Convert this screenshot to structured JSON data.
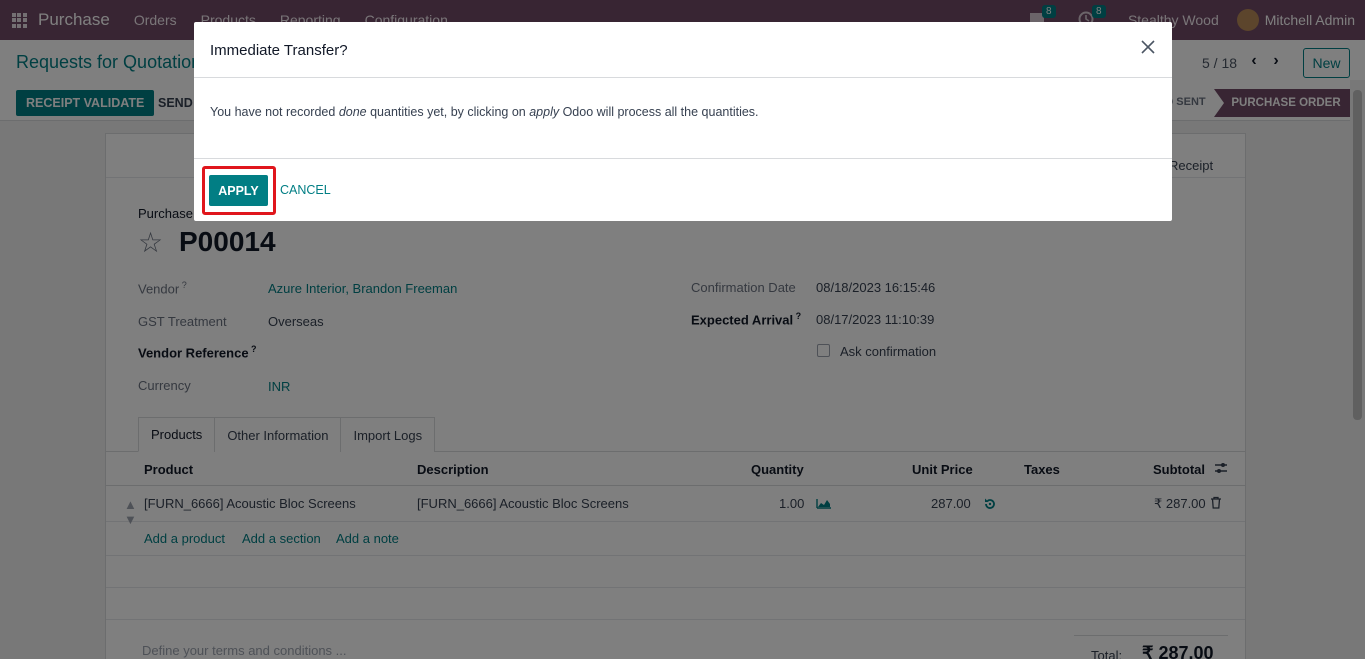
{
  "topnav": {
    "app_name": "Purchase",
    "menu": [
      "Orders",
      "Products",
      "Reporting",
      "Configuration"
    ],
    "chat_count": "8",
    "activity_count": "8",
    "company": "Stealthy Wood",
    "user": "Mitchell Admin"
  },
  "control": {
    "breadcrumb": "Requests for Quotation",
    "pager": "5 / 18",
    "new_label": "New",
    "validate_label": "RECEIPT VALIDATE",
    "send_label": "SEND",
    "status_sent": "RFQ SENT",
    "status_active": "PURCHASE ORDER"
  },
  "form": {
    "smart_button": "Receipt",
    "subtitle": "Purchase Order",
    "name": "P00014",
    "vendor_label": "Vendor",
    "vendor": "Azure Interior, Brandon Freeman",
    "gst_label": "GST Treatment",
    "gst": "Overseas",
    "vendor_ref_label": "Vendor Reference",
    "currency_label": "Currency",
    "currency": "INR",
    "confirmation_label": "Confirmation Date",
    "confirmation": "08/18/2023 16:15:46",
    "expected_label": "Expected Arrival",
    "expected": "08/17/2023 11:10:39",
    "ask_confirmation": "Ask confirmation",
    "tabs": [
      "Products",
      "Other Information",
      "Import Logs"
    ],
    "columns": {
      "product": "Product",
      "description": "Description",
      "quantity": "Quantity",
      "unit_price": "Unit Price",
      "taxes": "Taxes",
      "subtotal": "Subtotal"
    },
    "lines": [
      {
        "product": "[FURN_6666] Acoustic Bloc Screens",
        "description": "[FURN_6666] Acoustic Bloc Screens",
        "quantity": "1.00",
        "unit_price": "287.00",
        "subtotal": "₹ 287.00"
      }
    ],
    "add_product": "Add a product",
    "add_section": "Add a section",
    "add_note": "Add a note",
    "terms_placeholder": "Define your terms and conditions ...",
    "total_label": "Total:",
    "total_value": "₹ 287.00"
  },
  "dialog": {
    "title": "Immediate Transfer?",
    "body_part1": "You have not recorded ",
    "body_em1": "done",
    "body_part2": " quantities yet, by clicking on ",
    "body_em2": "apply",
    "body_part3": " Odoo will process all the quantities.",
    "apply_label": "APPLY",
    "cancel_label": "CANCEL"
  },
  "colors": {
    "brand": "#714b67",
    "primary": "#017e84",
    "highlight": "#e0161c"
  }
}
